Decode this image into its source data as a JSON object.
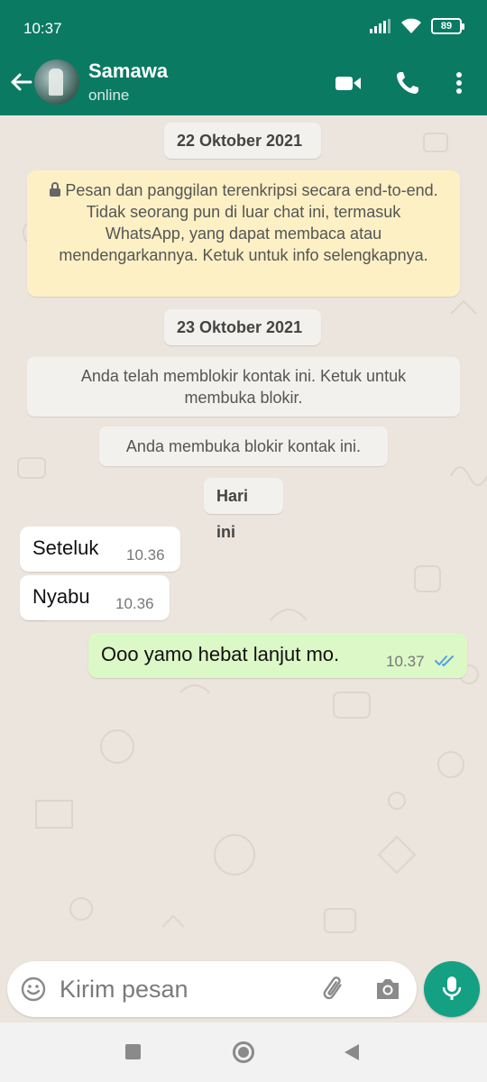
{
  "status": {
    "time": "10:37",
    "battery": "89"
  },
  "header": {
    "contact_name": "Samawa",
    "contact_status": "online"
  },
  "chat": {
    "date_1": "22 Oktober 2021",
    "encryption_notice": "Pesan dan panggilan terenkripsi secara end-to-end. Tidak seorang pun di luar chat ini, termasuk WhatsApp, yang dapat membaca atau mendengarkannya. Ketuk untuk info selengkapnya.",
    "date_2": "23 Oktober 2021",
    "blocked_notice": "Anda telah memblokir kontak ini. Ketuk untuk membuka blokir.",
    "unblocked_notice": "Anda membuka blokir kontak ini.",
    "date_3": "Hari ini",
    "messages": [
      {
        "direction": "in",
        "text": "Seteluk",
        "time": "10.36"
      },
      {
        "direction": "in",
        "text": "Nyabu",
        "time": "10.36"
      },
      {
        "direction": "out",
        "text": "Ooo yamo hebat lanjut mo.",
        "time": "10.37",
        "read": true
      }
    ]
  },
  "composer": {
    "placeholder": "Kirim pesan"
  },
  "colors": {
    "brand": "#0a7a63",
    "chat_bg": "#ece5dd",
    "outgoing_bubble": "#dcf8c6",
    "encryption_bubble": "#fdf0c4",
    "read_ticks": "#4fa3e0",
    "mic_button": "#14a083"
  }
}
